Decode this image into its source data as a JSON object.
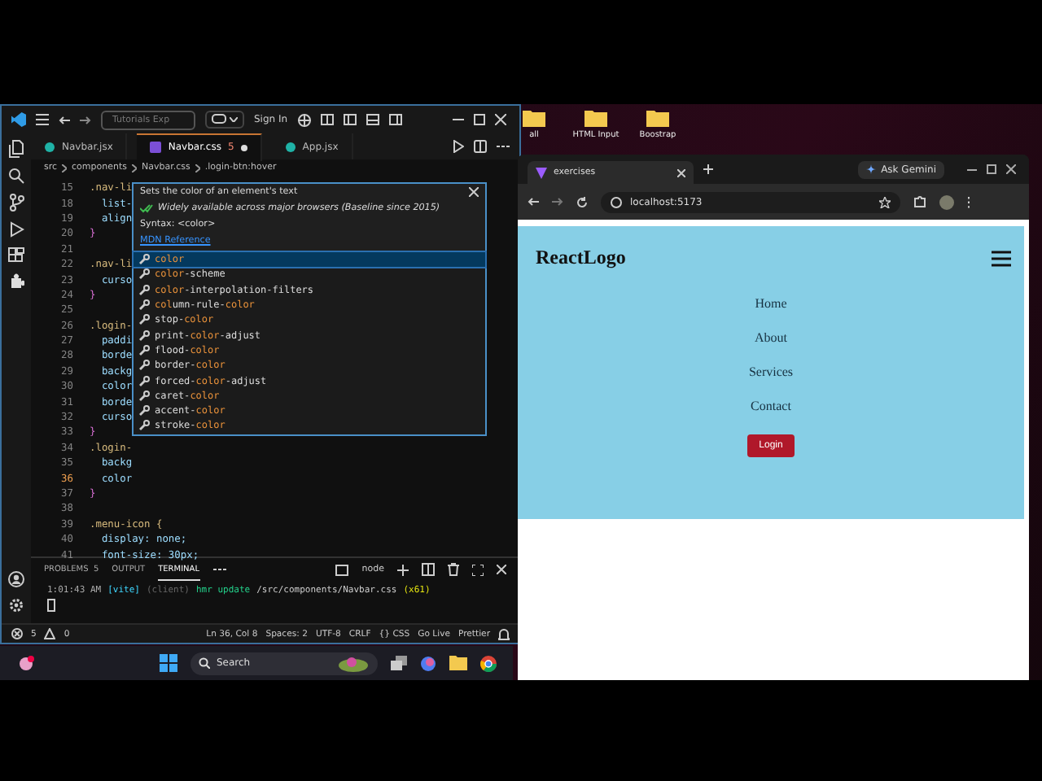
{
  "desktop": {
    "icons": [
      {
        "label": "all"
      },
      {
        "label": "HTML Input"
      },
      {
        "label": "Boostrap"
      }
    ]
  },
  "editor": {
    "title_bar": {
      "search": "Tutorials Exp",
      "sign_in": "Sign In"
    },
    "tabs": [
      {
        "label": "Navbar.jsx",
        "kind": "jsx",
        "selected": false,
        "modified": false
      },
      {
        "label": "Navbar.css",
        "kind": "css",
        "badge": "5",
        "selected": true,
        "modified": true
      },
      {
        "label": "App.jsx",
        "kind": "jsx",
        "selected": false,
        "modified": false
      }
    ],
    "breadcrumbs": [
      "src",
      "components",
      "Navbar.css",
      ".login-btn:hover"
    ],
    "code_lines": [
      {
        "number": "15",
        "text": ".nav-li",
        "kind": "selector",
        "current": false
      },
      {
        "number": "18",
        "text": "  list-",
        "kind": "property",
        "current": false
      },
      {
        "number": "19",
        "text": "  align",
        "kind": "property",
        "current": false
      },
      {
        "number": "20",
        "text": "}",
        "kind": "brace",
        "current": false
      },
      {
        "number": "21",
        "current": false
      },
      {
        "number": "22",
        "text": ".nav-li",
        "kind": "selector",
        "current": false
      },
      {
        "number": "23",
        "text": "  curso",
        "kind": "property",
        "current": false
      },
      {
        "number": "24",
        "text": "}",
        "kind": "brace",
        "current": false
      },
      {
        "number": "25",
        "current": false
      },
      {
        "number": "26",
        "text": ".login-",
        "kind": "selector",
        "current": false
      },
      {
        "number": "27",
        "text": "  paddi",
        "kind": "property",
        "current": false
      },
      {
        "number": "28",
        "text": "  borde",
        "kind": "property",
        "current": false
      },
      {
        "number": "29",
        "text": "  backg",
        "kind": "property",
        "current": false
      },
      {
        "number": "30",
        "text": "  color",
        "kind": "property",
        "current": false
      },
      {
        "number": "31",
        "text": "  borde",
        "kind": "property",
        "current": false
      },
      {
        "number": "32",
        "text": "  curso",
        "kind": "property",
        "current": false
      },
      {
        "number": "33",
        "text": "}",
        "kind": "brace",
        "current": false
      },
      {
        "number": "34",
        "text": ".login-",
        "kind": "selector",
        "current": false
      },
      {
        "number": "35",
        "text": "  backg",
        "kind": "property",
        "current": false
      },
      {
        "number": "36",
        "text": "  color",
        "kind": "property",
        "current": true
      },
      {
        "number": "37",
        "text": "}",
        "kind": "brace",
        "current": false
      },
      {
        "number": "38",
        "current": false
      },
      {
        "number": "39",
        "text": ".menu-icon {",
        "kind": "selector",
        "current": false
      },
      {
        "number": "40",
        "text": "  display: none;",
        "kind": "property",
        "current": false
      },
      {
        "number": "41",
        "text": "  font-size: 30px;",
        "kind": "property",
        "current": false
      }
    ],
    "hover": {
      "description": "Sets the color of an element's text",
      "baseline": "Widely available across major browsers (Baseline since 2015)",
      "syntax": "Syntax: <color>",
      "link": "MDN Reference"
    },
    "suggestions": [
      {
        "selected": true,
        "parts": [
          {
            "text": "color",
            "match": true
          }
        ]
      },
      {
        "selected": false,
        "parts": [
          {
            "text": "color",
            "match": true
          },
          {
            "text": "-scheme",
            "match": false
          }
        ]
      },
      {
        "selected": false,
        "parts": [
          {
            "text": "color",
            "match": true
          },
          {
            "text": "-interpolation-filters",
            "match": false
          }
        ]
      },
      {
        "selected": false,
        "parts": [
          {
            "text": "col",
            "match": true
          },
          {
            "text": "umn-rule-",
            "match": false
          },
          {
            "text": "color",
            "match": true
          }
        ]
      },
      {
        "selected": false,
        "parts": [
          {
            "text": "stop-",
            "match": false
          },
          {
            "text": "color",
            "match": true
          }
        ]
      },
      {
        "selected": false,
        "parts": [
          {
            "text": "print-",
            "match": false
          },
          {
            "text": "color",
            "match": true
          },
          {
            "text": "-adjust",
            "match": false
          }
        ]
      },
      {
        "selected": false,
        "parts": [
          {
            "text": "flood-",
            "match": false
          },
          {
            "text": "color",
            "match": true
          }
        ]
      },
      {
        "selected": false,
        "parts": [
          {
            "text": "border-",
            "match": false
          },
          {
            "text": "color",
            "match": true
          }
        ]
      },
      {
        "selected": false,
        "parts": [
          {
            "text": "forced-",
            "match": false
          },
          {
            "text": "color",
            "match": true
          },
          {
            "text": "-adjust",
            "match": false
          }
        ]
      },
      {
        "selected": false,
        "parts": [
          {
            "text": "caret-",
            "match": false
          },
          {
            "text": "color",
            "match": true
          }
        ]
      },
      {
        "selected": false,
        "parts": [
          {
            "text": "accent-",
            "match": false
          },
          {
            "text": "color",
            "match": true
          }
        ]
      },
      {
        "selected": false,
        "parts": [
          {
            "text": "stroke-",
            "match": false
          },
          {
            "text": "color",
            "match": true
          }
        ]
      }
    ],
    "panel": {
      "tabs": [
        {
          "label": "PROBLEMS",
          "badge": "5",
          "selected": false
        },
        {
          "label": "OUTPUT",
          "selected": false
        },
        {
          "label": "TERMINAL",
          "selected": true
        }
      ],
      "shell": "node",
      "terminal_line": [
        {
          "text": "1:01:43 AM",
          "kind": "time"
        },
        {
          "text": "[vite]",
          "kind": "tag"
        },
        {
          "text": "(client)",
          "kind": "dim"
        },
        {
          "text": "hmr update",
          "kind": "accent"
        },
        {
          "text": "/src/components/Navbar.css",
          "kind": "path"
        },
        {
          "text": "(x61)",
          "kind": "count"
        }
      ]
    },
    "status_bar": {
      "errors": "5",
      "warnings": "0",
      "items": [
        "Ln 36, Col 8",
        "Spaces: 2",
        "UTF-8",
        "CRLF",
        "{} CSS",
        "Go Live",
        "Prettier"
      ]
    }
  },
  "taskbar": {
    "search": "Search"
  },
  "browser": {
    "tab": "exercises",
    "gemini": "Ask Gemini",
    "url": "localhost:5173",
    "page": {
      "logo": "ReactLogo",
      "nav": [
        "Home",
        "About",
        "Services",
        "Contact"
      ],
      "button": "Login"
    }
  }
}
